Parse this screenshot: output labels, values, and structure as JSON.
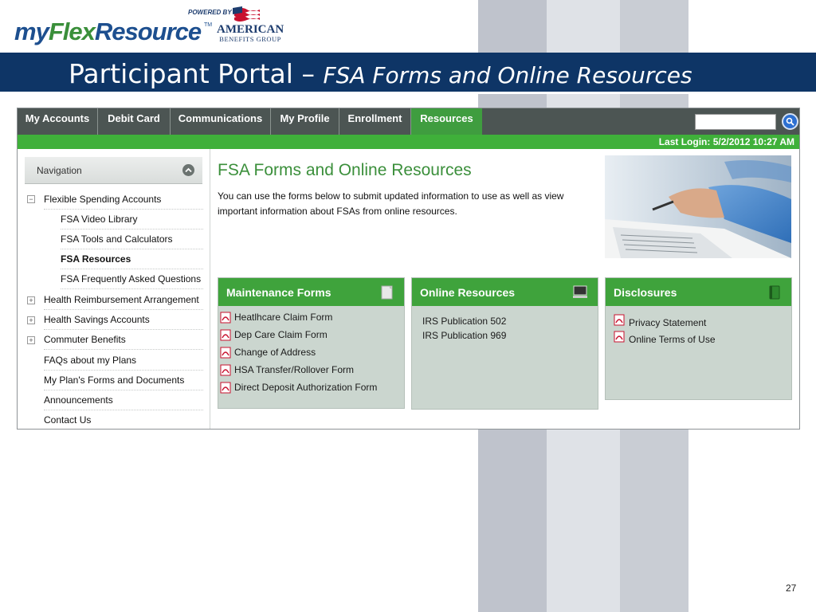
{
  "logo": {
    "my": "my",
    "flex": "Flex",
    "resource": "Resource",
    "tm": "TM",
    "powered_by": "POWERED BY",
    "company_line1": "AMERICAN",
    "company_line2": "BENEFITS GROUP"
  },
  "title": {
    "main": "Participant Portal – ",
    "sub": "FSA Forms and Online Resources"
  },
  "nav": {
    "tabs": [
      {
        "label": "My Accounts"
      },
      {
        "label": "Debit Card"
      },
      {
        "label": "Communications"
      },
      {
        "label": "My Profile"
      },
      {
        "label": "Enrollment"
      },
      {
        "label": "Resources",
        "active": true
      }
    ],
    "search_placeholder": "",
    "last_login": "Last Login: 5/2/2012 10:27 AM"
  },
  "sidebar": {
    "heading": "Navigation",
    "items": [
      {
        "label": "Flexible Spending Accounts",
        "expander": "−"
      },
      {
        "label": "FSA Video Library"
      },
      {
        "label": "FSA Tools and Calculators"
      },
      {
        "label": "FSA Resources",
        "selected": true
      },
      {
        "label": "FSA Frequently Asked Questions"
      },
      {
        "label": "Health Reimbursement Arrangement",
        "expander": "+"
      },
      {
        "label": "Health Savings Accounts",
        "expander": "+"
      },
      {
        "label": "Commuter Benefits",
        "expander": "+"
      },
      {
        "label": "FAQs about my Plans"
      },
      {
        "label": "My Plan's Forms and Documents"
      },
      {
        "label": "Announcements"
      },
      {
        "label": "Contact Us"
      }
    ]
  },
  "content": {
    "title": "FSA Forms and Online Resources",
    "description": "You can use the forms below to submit updated information to use as well as view important information about FSAs from online resources."
  },
  "panels": {
    "maintenance": {
      "title": "Maintenance Forms",
      "links": [
        "Heatlhcare Claim Form",
        "Dep Care Claim Form",
        "Change of Address",
        "HSA Transfer/Rollover Form",
        "Direct Deposit Authorization Form"
      ]
    },
    "online": {
      "title": "Online Resources",
      "links": [
        "IRS Publication 502",
        "IRS Publication 969"
      ]
    },
    "disclosures": {
      "title": "Disclosures",
      "links": [
        "Privacy Statement",
        "Online Terms of Use"
      ]
    }
  },
  "page_number": "27",
  "colors": {
    "title_bar": "#0e3566",
    "nav_bar": "#4c5553",
    "accent_green": "#3fa33c",
    "panel_bg": "#cbd6cf",
    "content_title": "#3b8f3b"
  }
}
